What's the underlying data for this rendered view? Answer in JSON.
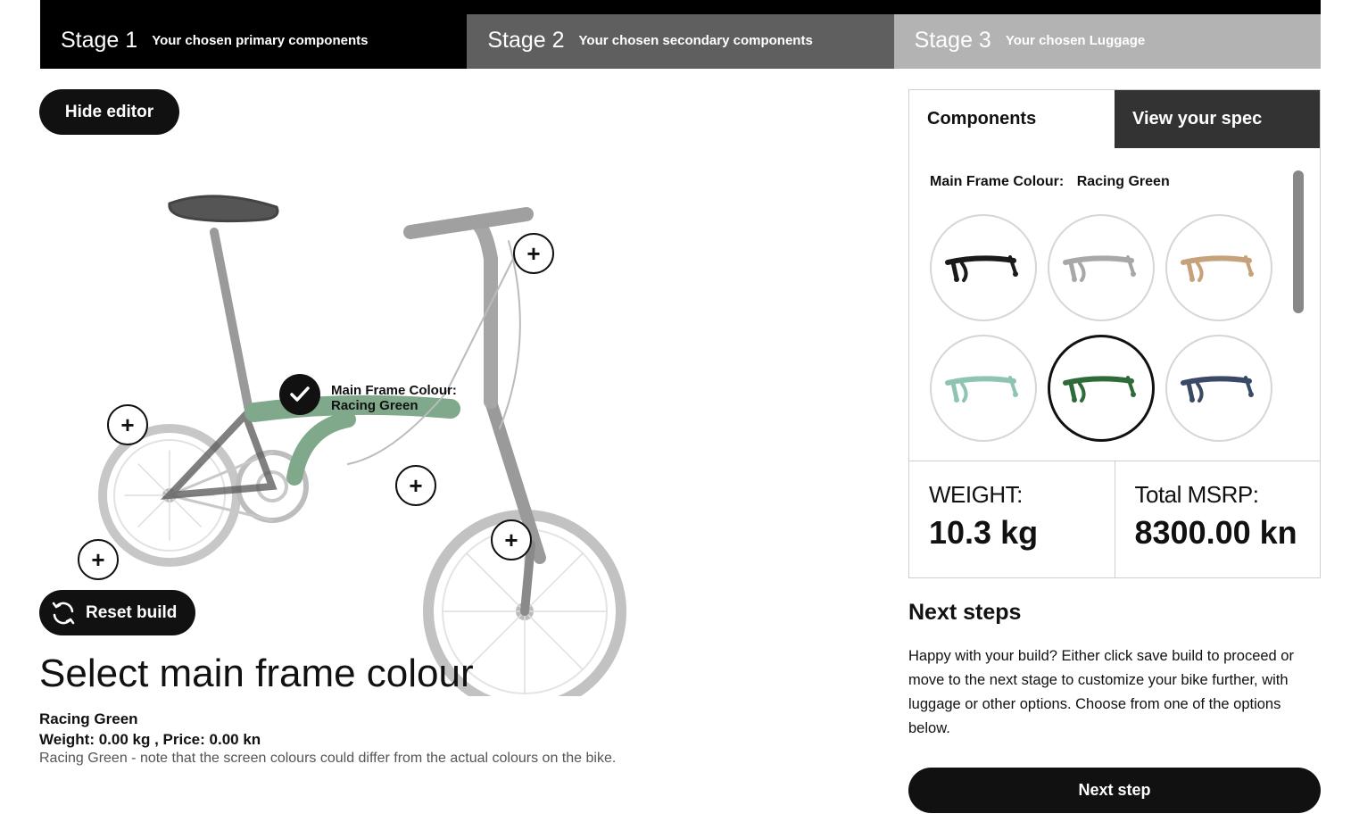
{
  "stages": [
    {
      "num": "Stage 1",
      "desc": "Your chosen primary components"
    },
    {
      "num": "Stage 2",
      "desc": "Your chosen secondary components"
    },
    {
      "num": "Stage 3",
      "desc": "Your chosen Luggage"
    }
  ],
  "editor": {
    "hide_label": "Hide editor",
    "reset_label": "Reset build"
  },
  "bike": {
    "hotspot_symbol": "+",
    "frame_label_line1": "Main Frame Colour:",
    "frame_label_line2": "Racing Green",
    "frame_color": "#7fa98a"
  },
  "selection": {
    "title": "Select main frame colour",
    "name": "Racing Green",
    "weight_price": "Weight: 0.00 kg , Price: 0.00 kn",
    "note": "Racing Green -  note that the screen colours could differ from the actual colours on the bike."
  },
  "panel": {
    "tabs": [
      {
        "label": "Components"
      },
      {
        "label": "View your spec"
      }
    ],
    "component_label": "Main Frame Colour:",
    "component_value": "Racing Green",
    "swatches": [
      {
        "color": "#1a1a1a",
        "selected": false
      },
      {
        "color": "#a8a8a8",
        "selected": false
      },
      {
        "color": "#c6a27a",
        "selected": false
      },
      {
        "color": "#8fc4b4",
        "selected": false
      },
      {
        "color": "#2f6b3a",
        "selected": true
      },
      {
        "color": "#3a4a66",
        "selected": false
      }
    ],
    "weight_label": "WEIGHT:",
    "weight_value": "10.3 kg",
    "msrp_label": "Total MSRP:",
    "msrp_value": "8300.00 kn"
  },
  "next_steps": {
    "title": "Next steps",
    "text": "Happy with your build? Either click save build to proceed or move to the next stage to customize your bike further, with luggage or other options. Choose from one of the options below.",
    "button": "Next step"
  }
}
